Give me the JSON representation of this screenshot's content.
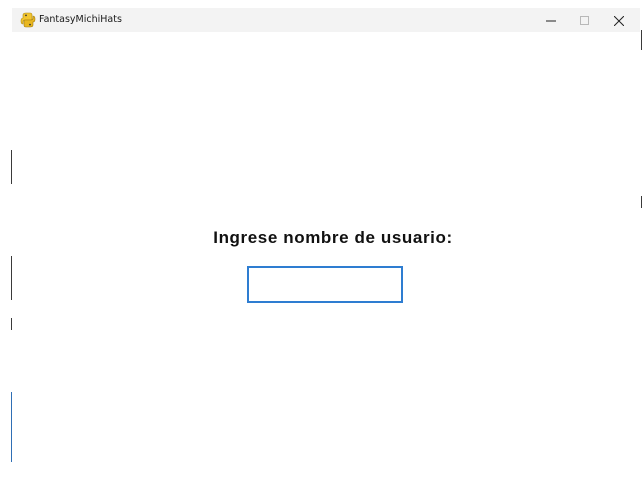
{
  "window": {
    "title": "FantasyMichiHats",
    "icon": "python-snake-icon"
  },
  "caption_buttons": {
    "minimize": "minimize-icon",
    "maximize": "maximize-icon",
    "close": "close-icon"
  },
  "login": {
    "prompt": "Ingrese nombre de usuario:",
    "username_value": "",
    "accent_color": "#2e7dd1"
  }
}
